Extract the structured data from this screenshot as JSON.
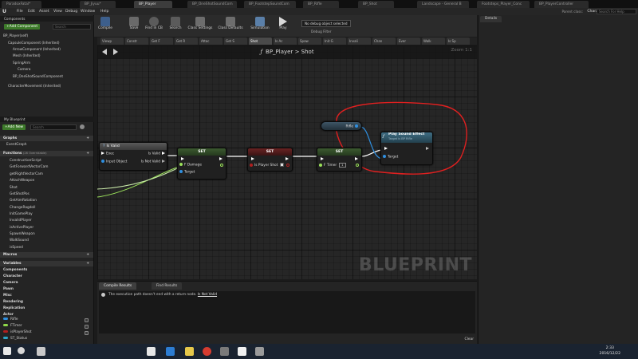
{
  "window_tabs": [
    {
      "label": "ParadoxFatal*",
      "active": false
    },
    {
      "label": "BP_Jiyuu*",
      "active": false
    },
    {
      "label": "BP_Player",
      "active": true
    },
    {
      "label": "BP_OneShotSoundCom",
      "active": false
    },
    {
      "label": "BP_FootstepSoundCom",
      "active": false
    },
    {
      "label": "BP_Rifle",
      "active": false
    },
    {
      "label": "BP_Shot",
      "active": false
    },
    {
      "label": "Landscape - General B",
      "active": false
    },
    {
      "label": "Footsteps_Player_Conc",
      "active": false
    },
    {
      "label": "BP_PlayerController",
      "active": false
    }
  ],
  "menu": [
    "File",
    "Edit",
    "Asset",
    "View",
    "Debug",
    "Window",
    "Help"
  ],
  "parent_class": {
    "label": "Parent class:",
    "value": "Character"
  },
  "help_search": {
    "placeholder": "Search For Help"
  },
  "toolbar": {
    "buttons": [
      "Compile",
      "Save",
      "Find in CB",
      "Search",
      "Class Settings",
      "Class Defaults",
      "Simulation",
      "Play"
    ],
    "debug_select": "No debug object selected",
    "debug_filter": "Debug Filter"
  },
  "components": {
    "header": "Components",
    "add_button": "+Add Component",
    "search_placeholder": "Search",
    "self": "BP_Player(self)",
    "items": [
      "CapsuleComponent (Inherited)",
      "ArrowComponent (Inherited)",
      "Mesh (Inherited)",
      "SpringArm",
      "Camera",
      "BP_OneShotSoundComponent",
      "CharacterMovement (Inherited)"
    ]
  },
  "my_blueprint": {
    "header": "My Blueprint",
    "add_button": "+Add New",
    "search_placeholder": "Search",
    "graphs_label": "Graphs",
    "event_graph": "EventGraph",
    "functions_label": "Functions",
    "functions_count": "(26 Overridable)",
    "functions": [
      "ConstructionScript",
      "GetForwardVectorCam",
      "getRightVectorCam",
      "AttachWeapon",
      "Shot",
      "GetShotPos",
      "GetAimRotation",
      "ChangeRagdoll",
      "InitGamePlay",
      "InvalidPlayer",
      "isActivePlayer",
      "SpawnWeapon",
      "WalkSound",
      "isSpeed"
    ],
    "macros_label": "Macros",
    "variables_label": "Variables",
    "variable_categories": [
      "Components",
      "Character",
      "Camera",
      "Pawn",
      "Misc",
      "Rendering",
      "Replication",
      "Actor"
    ],
    "variables": [
      {
        "name": "Rifle",
        "color": "#2f8fe0"
      },
      {
        "name": "FTimer",
        "color": "#8fd84a"
      },
      {
        "name": "isPlayerShot",
        "color": "#b11f1f"
      },
      {
        "name": "ST_Status",
        "color": "#2fa6c8"
      }
    ]
  },
  "graph_tabs": [
    "Viewp",
    "Constr",
    "Get F",
    "Get R",
    "Attac",
    "Get S",
    "Shot",
    "Is Ac",
    "Spaw",
    "Init G",
    "Invali",
    "Chan",
    "Ever",
    "Walk",
    "Is Sp"
  ],
  "graph_tab_active": "Shot",
  "graph": {
    "title": "BP_Player > Shot",
    "zoom": "Zoom 1:1",
    "watermark": "BLUEPRINT",
    "nodes": {
      "is_valid": {
        "title": "Is Valid",
        "exec": "Exec",
        "input": "Input Object",
        "out_valid": "Is Valid",
        "out_not_valid": "Is Not Valid"
      },
      "set_damage": {
        "title": "SET",
        "pin": "F Damage",
        "target": "Target"
      },
      "set_shot": {
        "title": "SET",
        "pin": "Is Player Shot"
      },
      "set_timer": {
        "title": "SET",
        "pin": "F Timer",
        "value": "1"
      },
      "rifle": {
        "title": "Rifle"
      },
      "play_sound": {
        "title": "Play Sound Effect",
        "subtitle": "Target is BP Rifle",
        "target": "Target"
      }
    }
  },
  "bottom": {
    "tabs": [
      "Compile Results",
      "Find Results"
    ],
    "message": "The execution path doesn't end with a return node.",
    "message_link": "Is Not Valid",
    "clear": "Clear"
  },
  "details": {
    "tab": "Details"
  },
  "taskbar": {
    "time": "2:33",
    "date": "2016/12/22"
  }
}
